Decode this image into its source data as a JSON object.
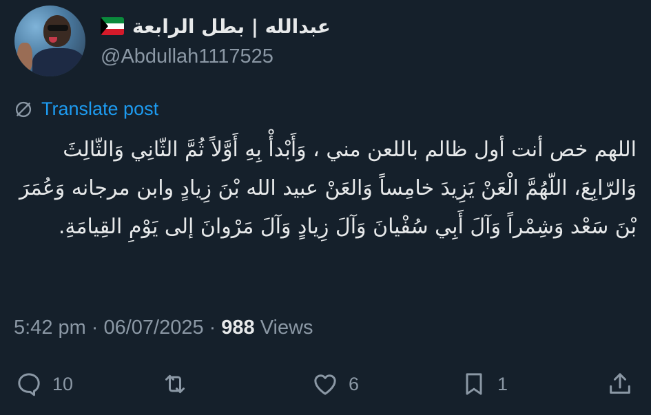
{
  "author": {
    "display_name": "عبدالله | بطل الرابعة",
    "handle": "@Abdullah1117525",
    "flag_icon": "kuwait-flag-icon"
  },
  "translate": {
    "label": "Translate post",
    "icon": "globe-icon"
  },
  "tweet": {
    "text": "اللهم خص أنت أول ظالم باللعن مني ، وَأَبْدأْ بِهِ أَوَّلاً ثُمَّ الثّانِي وَالثّالِثَ وَالرّابِعَ، اللّهُمَّ الْعَنْ يَزِيدَ خامِساً وَالعَنْ عبيد الله بْنَ زِيادٍ وابن مرجانه وَعُمَرَ بْنَ سَعْد وَشِمْراً وَآلَ أَبِي سُفْيانَ وَآلَ زِيادٍ وَآلَ مَرْوانَ إلى يَوْمِ القِيامَةِ."
  },
  "meta": {
    "time": "5:42 pm",
    "separator": "·",
    "date": "06/07/2025",
    "views_count": "988",
    "views_label": "Views"
  },
  "actions": {
    "reply_count": "10",
    "repost_count": "",
    "like_count": "6",
    "bookmark_count": "1"
  },
  "colors": {
    "background": "#15202b",
    "text": "#e7e9ea",
    "secondary": "#8b98a5",
    "accent": "#1d9bf0"
  }
}
